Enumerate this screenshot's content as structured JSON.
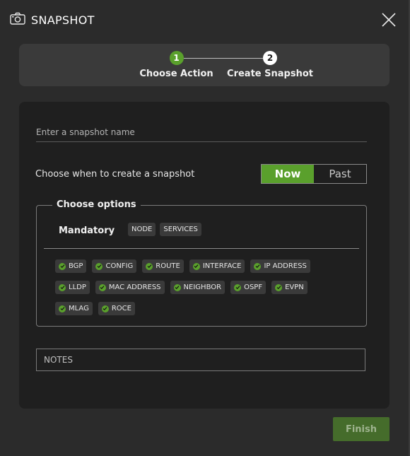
{
  "header": {
    "title": "SNAPSHOT",
    "icon": "camera-icon",
    "close_icon": "close-icon"
  },
  "stepper": {
    "steps": [
      {
        "number": "1",
        "label": "Choose Action",
        "state": "completed"
      },
      {
        "number": "2",
        "label": "Create Snapshot",
        "state": "active"
      }
    ]
  },
  "form": {
    "name_placeholder": "Enter a snapshot name",
    "name_value": "",
    "when_label": "Choose when to create a snapshot",
    "toggle": {
      "now": "Now",
      "past": "Past",
      "selected": "Now"
    },
    "options_title": "Choose options",
    "mandatory_label": "Mandatory",
    "mandatory": [
      "NODE",
      "SERVICES"
    ],
    "optional": [
      "BGP",
      "CONFIG",
      "ROUTE",
      "INTERFACE",
      "IP ADDRESS",
      "LLDP",
      "MAC ADDRESS",
      "NEIGHBOR",
      "OSPF",
      "EVPN",
      "MLAG",
      "ROCE"
    ],
    "notes_placeholder": "NOTES"
  },
  "footer": {
    "finish_label": "Finish"
  },
  "colors": {
    "accent": "#5aa02c",
    "background": "#2b2b2b",
    "panel": "#1f1f1f"
  }
}
